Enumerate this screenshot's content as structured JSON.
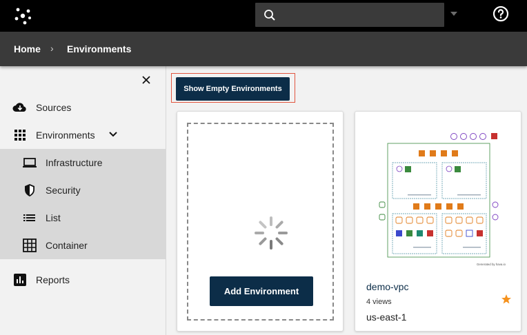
{
  "topbar": {
    "logo_icon": "hava-logo-icon",
    "search_placeholder": "",
    "search_icon": "search-icon",
    "help_icon": "help-circle-icon"
  },
  "breadcrumb": {
    "home": "Home",
    "separator": "›",
    "current": "Environments"
  },
  "sidebar": {
    "close_icon": "close-icon",
    "items": [
      {
        "label": "Sources",
        "icon": "cloud-download-icon"
      },
      {
        "label": "Environments",
        "icon": "grid-icon",
        "expanded": true
      },
      {
        "label": "Infrastructure",
        "icon": "laptop-icon",
        "sub": true
      },
      {
        "label": "Security",
        "icon": "shield-icon",
        "sub": true
      },
      {
        "label": "List",
        "icon": "list-icon",
        "sub": true
      },
      {
        "label": "Container",
        "icon": "table-icon",
        "sub": true
      },
      {
        "label": "Reports",
        "icon": "bar-chart-icon"
      }
    ]
  },
  "main": {
    "show_empty_label": "Show Empty Environments",
    "add_card": {
      "add_label": "Add Environment",
      "loading_icon": "spinner-icon"
    },
    "environments": [
      {
        "name": "demo-vpc",
        "views": "4 views",
        "region": "us-east-1",
        "favorite": true,
        "thumbnail_caption": "Generated by hava.io"
      }
    ]
  },
  "colors": {
    "topbar_bg": "#000000",
    "breadcrumb_bg": "#3a3a3a",
    "primary_button": "#0c2d48",
    "highlight_border": "#e2553f",
    "star": "#f5921e",
    "aws_orange": "#e07b1a",
    "aws_green": "#3b8a3e",
    "aws_red": "#c7312f",
    "aws_purple": "#7b3fc0",
    "aws_blue": "#3b48cc"
  }
}
